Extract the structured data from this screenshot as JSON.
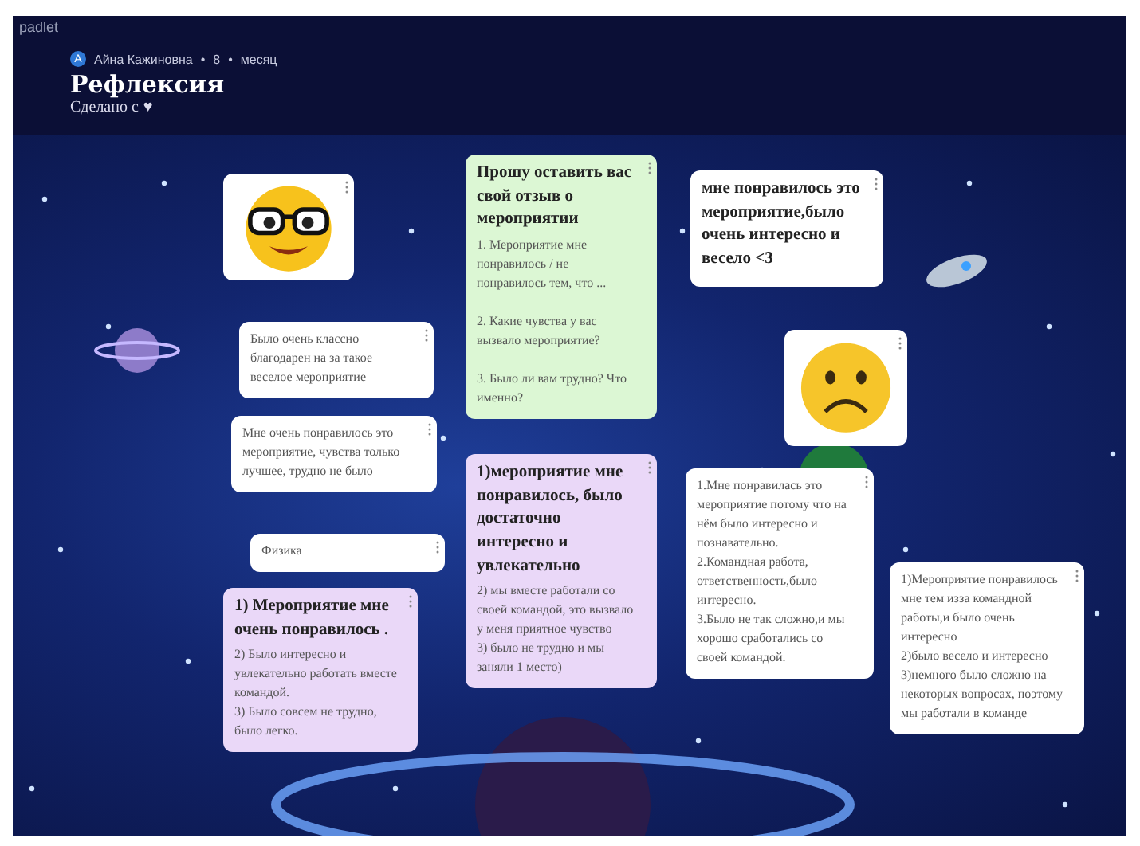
{
  "app": {
    "logo": "padlet"
  },
  "header": {
    "avatar_letter": "А",
    "author": "Айна Кажиновна",
    "separator_1": "•",
    "count": "8",
    "separator_2": "•",
    "period": "месяц",
    "title": "Рефлексия",
    "subtitle": "Сделано с",
    "heart": "♥"
  },
  "cards": [
    {
      "kind": "smiley",
      "color": "#ffffff"
    },
    {
      "kind": "text",
      "color": "#ffffff",
      "body": "Было очень классно благодарен на за такое веселое мероприятие"
    },
    {
      "kind": "text",
      "color": "#ffffff",
      "body": "Мне очень понравилось это мероприятие, чувства только лучшее, трудно не было"
    },
    {
      "kind": "text",
      "color": "#ffffff",
      "body": "Физика"
    },
    {
      "kind": "text",
      "color": "#ead8f8",
      "title": "1) Мероприятие мне очень понравилось .",
      "body": "2) Было интересно и увлекательно работать вместе командой.\n3) Было совсем не трудно, было легко."
    },
    {
      "kind": "text",
      "color": "#dcf7d4",
      "title": "Прошу оставить вас свой отзыв о мероприятии",
      "body": "1. Мероприятие мне понравилось / не понравилось тем, что ...\n\n2. Какие чувства у вас вызвало мероприятие?\n\n3. Было ли вам трудно? Что именно?"
    },
    {
      "kind": "text",
      "color": "#ead8f8",
      "title": "1)мероприятие мне понравилось, было достаточно интересно и увлекательно",
      "body": "2) мы вместе работали со своей командой, это вызвало у меня приятное чувство\n3) было не трудно и мы заняли 1 место)"
    },
    {
      "kind": "text",
      "color": "#ffffff",
      "title": "мне понравилось это мероприятие,было очень интересно и весело <3"
    },
    {
      "kind": "frown",
      "color": "#ffffff"
    },
    {
      "kind": "text",
      "color": "#ffffff",
      "body": "1.Мне понравилась это мероприятие потому что на нём было интересно и познавательно.\n2.Командная работа, ответственность,было интересно.\n3.Было не так сложно,и мы хорошо сработались со своей командой."
    },
    {
      "kind": "text",
      "color": "#ffffff",
      "body": "1)Мероприятие понравилось мне тем изза командной работы,и было очень интересно\n2)было весело и интересно\n3)немного было сложно на некоторых вопросах, поэтому мы работали в команде"
    }
  ]
}
